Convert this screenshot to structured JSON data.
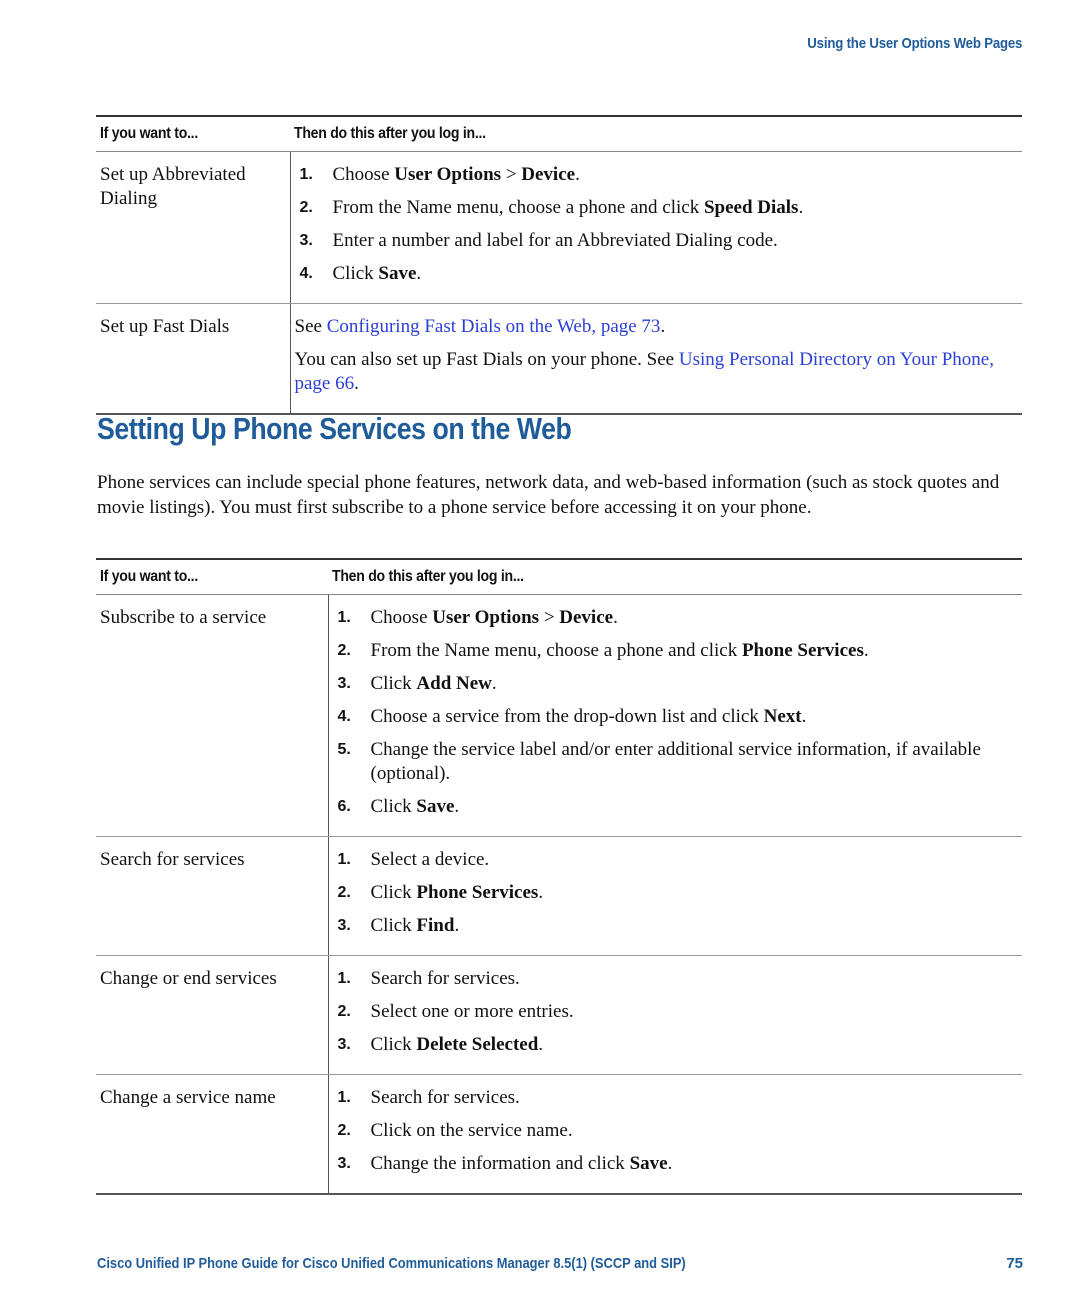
{
  "running_header": "Using the User Options Web Pages",
  "table1": {
    "headers": [
      "If you want to...",
      "Then do this after you log in..."
    ],
    "rows": [
      {
        "want": "Set up Abbreviated Dialing",
        "steps": [
          {
            "num": "1.",
            "html": "Choose <b>User Options</b> &gt; <b>Device</b>."
          },
          {
            "num": "2.",
            "html": "From the Name menu, choose a phone and click <b>Speed Dials</b>."
          },
          {
            "num": "3.",
            "html": "Enter a number and label for an Abbreviated Dialing code."
          },
          {
            "num": "4.",
            "html": "Click <b>Save</b>."
          }
        ]
      },
      {
        "want": "Set up Fast Dials",
        "paras": [
          {
            "pre": "See ",
            "link": "Configuring Fast Dials on the Web, page 73",
            "post": "."
          },
          {
            "pre": "You can also set up Fast Dials on your phone. See ",
            "link": "Using Personal Directory on Your Phone, page 66",
            "post": "."
          }
        ]
      }
    ]
  },
  "section": {
    "title": "Setting Up Phone Services on the Web",
    "intro": "Phone services can include special phone features, network data, and web-based information (such as stock quotes and movie listings). You must first subscribe to a phone service before accessing it on your phone."
  },
  "table2": {
    "headers": [
      "If you want to...",
      "Then do this after you log in..."
    ],
    "rows": [
      {
        "want": "Subscribe to a service",
        "steps": [
          {
            "num": "1.",
            "html": "Choose <b>User Options</b> &gt; <b>Device</b>."
          },
          {
            "num": "2.",
            "html": "From the Name menu, choose a phone and click <b>Phone Services</b>."
          },
          {
            "num": "3.",
            "html": "Click <b>Add New</b>."
          },
          {
            "num": "4.",
            "html": "Choose a service from the drop-down list and click <b>Next</b>."
          },
          {
            "num": "5.",
            "html": "Change the service label and/or enter additional service information, if available (optional)."
          },
          {
            "num": "6.",
            "html": "Click <b>Save</b>."
          }
        ]
      },
      {
        "want": "Search for services",
        "steps": [
          {
            "num": "1.",
            "html": "Select a device."
          },
          {
            "num": "2.",
            "html": "Click <b>Phone Services</b>."
          },
          {
            "num": "3.",
            "html": "Click <b>Find</b>."
          }
        ]
      },
      {
        "want": "Change or end services",
        "steps": [
          {
            "num": "1.",
            "html": "Search for services."
          },
          {
            "num": "2.",
            "html": "Select one or more entries."
          },
          {
            "num": "3.",
            "html": "Click <b>Delete Selected</b>."
          }
        ]
      },
      {
        "want": "Change a service name",
        "steps": [
          {
            "num": "1.",
            "html": "Search for services."
          },
          {
            "num": "2.",
            "html": "Click on the service name."
          },
          {
            "num": "3.",
            "html": "Change the information and click <b>Save</b>."
          }
        ]
      }
    ]
  },
  "footer": {
    "title": "Cisco Unified IP Phone Guide for Cisco Unified Communications Manager 8.5(1) (SCCP and SIP)",
    "page_number": "75"
  },
  "colors": {
    "heading_blue": "#1f5c99",
    "link_blue": "#2a3fd6"
  }
}
